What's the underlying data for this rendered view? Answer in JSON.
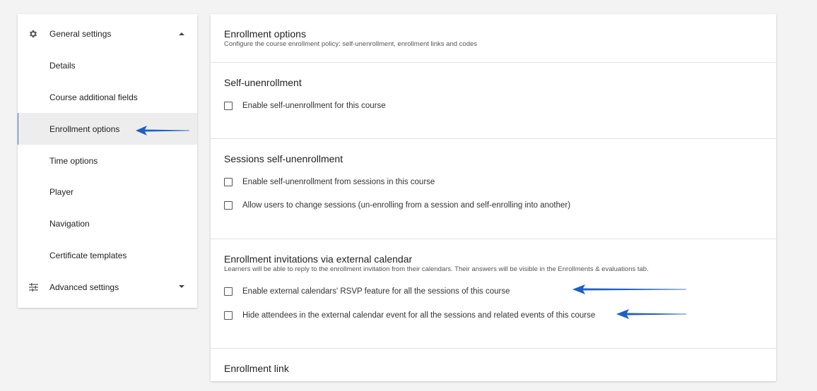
{
  "sidebar": {
    "general_settings": "General settings",
    "items": [
      {
        "label": "Details",
        "active": false
      },
      {
        "label": "Course additional fields",
        "active": false
      },
      {
        "label": "Enrollment options",
        "active": true
      },
      {
        "label": "Time options",
        "active": false
      },
      {
        "label": "Player",
        "active": false
      },
      {
        "label": "Navigation",
        "active": false
      },
      {
        "label": "Certificate templates",
        "active": false
      }
    ],
    "advanced_settings": "Advanced settings"
  },
  "main": {
    "header": {
      "title": "Enrollment options",
      "description": "Configure the course enrollment policy: self-unenrollment, enrollment links and codes"
    },
    "sections": [
      {
        "title": "Self-unenrollment",
        "options": [
          {
            "label": "Enable self-unenrollment for this course",
            "checked": false
          }
        ]
      },
      {
        "title": "Sessions self-unenrollment",
        "options": [
          {
            "label": "Enable self-unenrollment from sessions in this course",
            "checked": false
          },
          {
            "label": "Allow users to change sessions (un-enrolling from a session and self-enrolling into another)",
            "checked": false
          }
        ]
      },
      {
        "title": "Enrollment invitations via external calendar",
        "description": "Learners will be able to reply to the enrollment invitation from their calendars. Their answers will be visible in the Enrollments & evaluations tab.",
        "options": [
          {
            "label": "Enable external calendars' RSVP feature for all the sessions of this course",
            "checked": false
          },
          {
            "label": "Hide attendees in the external calendar event for all the sessions and related events of this course",
            "checked": false
          }
        ]
      },
      {
        "title": "Enrollment link"
      }
    ]
  },
  "colors": {
    "annotation_arrow": "#1f5fc4",
    "active_border": "#3f76c4",
    "active_bg": "#ededed",
    "page_bg": "#f3f3f3"
  },
  "icons": {
    "general_settings": "gear-icon",
    "advanced_settings": "sliders-icon",
    "expanded_caret": "caret-up-icon",
    "collapsed_caret": "caret-down-icon"
  }
}
